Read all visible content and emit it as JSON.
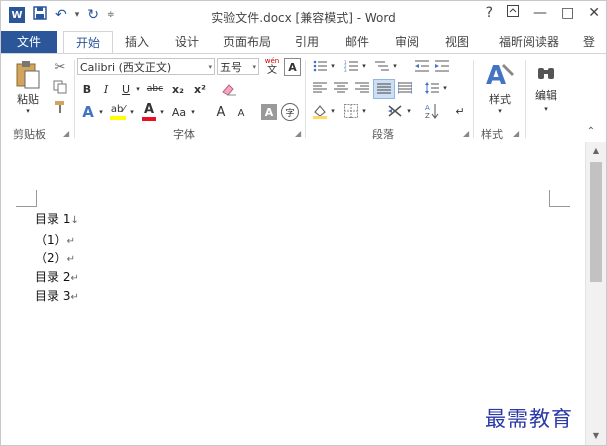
{
  "titlebar": {
    "title": "实验文件.docx [兼容模式] - Word",
    "help": "?",
    "restore_ribbon": "⊼",
    "minimize": "—",
    "maximize": "□",
    "close": "✕"
  },
  "tabs": [
    {
      "label": "文件"
    },
    {
      "label": "开始"
    },
    {
      "label": "插入"
    },
    {
      "label": "设计"
    },
    {
      "label": "页面布局"
    },
    {
      "label": "引用"
    },
    {
      "label": "邮件"
    },
    {
      "label": "审阅"
    },
    {
      "label": "视图"
    },
    {
      "label": "福昕阅读器"
    },
    {
      "label": "登"
    }
  ],
  "ribbon": {
    "clipboard": {
      "paste_label": "粘贴",
      "group_label": "剪贴板"
    },
    "font": {
      "font_name": "Calibri (西文正文)",
      "font_size": "五号",
      "phonetic_top": "wén",
      "phonetic_bottom": "文",
      "char_border": "A",
      "bold": "B",
      "italic": "I",
      "underline": "U",
      "strike": "abc",
      "subscript": "x₂",
      "superscript": "x²",
      "aa_label": "Aa",
      "grow": "A",
      "shrink": "A",
      "char_shading": "A",
      "enclose": "字",
      "group_label": "字体"
    },
    "paragraph": {
      "group_label": "段落"
    },
    "styles": {
      "label": "样式",
      "group_label": "样式"
    },
    "editing": {
      "label": "编辑"
    }
  },
  "document": {
    "paragraphs": [
      {
        "text": "目录 1",
        "mark": "↓"
      },
      {
        "text": "（1）",
        "mark": "↵"
      },
      {
        "text": "（2）",
        "mark": "↵"
      },
      {
        "text": "目录 2",
        "mark": "↵"
      },
      {
        "text": "目录 3",
        "mark": "↵"
      }
    ]
  },
  "watermark": "最需教育",
  "colors": {
    "accent": "#2b579a",
    "highlight_yellow": "#ffff00",
    "font_color_red": "#e81123"
  }
}
